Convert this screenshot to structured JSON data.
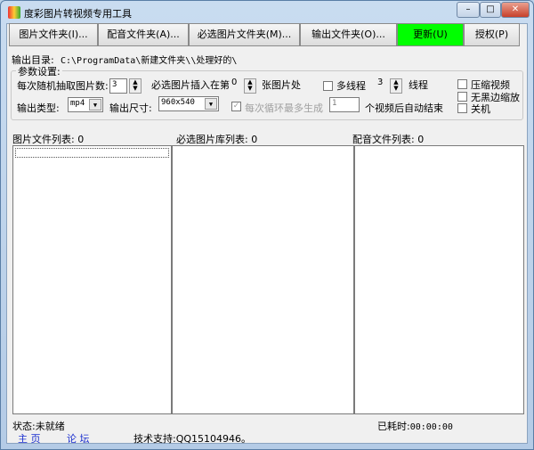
{
  "window": {
    "title": "度彩图片转视频专用工具",
    "controls": [
      "minimize",
      "maximize",
      "close"
    ]
  },
  "toolbar": [
    {
      "label": "图片文件夹(I)..."
    },
    {
      "label": "配音文件夹(A)..."
    },
    {
      "label": "必选图片文件夹(M)..."
    },
    {
      "label": "输出文件夹(O)..."
    },
    {
      "label": "更新(U)"
    },
    {
      "label": "授权(P)"
    }
  ],
  "colors": {
    "update_button": "#00ff00"
  },
  "output_dir": {
    "label": "输出目录:",
    "value": "C:\\ProgramData\\新建文件夹\\\\处理好的\\"
  },
  "params": {
    "legend": "参数设置:",
    "random_count_label": "每次随机抽取图片数:",
    "random_count": "3",
    "insert_label": "必选图片插入在第",
    "insert_value": "0",
    "insert_suffix": "张图片处",
    "multithread_label": "多线程",
    "multithread_checked": false,
    "threads": "3",
    "threads_suffix": "线程",
    "compress_label": "压缩视频",
    "compress_checked": false,
    "noblack_label": "无黑边缩放",
    "noblack_checked": false,
    "shutdown_label": "关机",
    "shutdown_checked": false,
    "type_label": "输出类型:",
    "type_value": "mp4",
    "size_label": "输出尺寸:",
    "size_value": "960x540",
    "loop_label": "每次循环最多生成",
    "loop_checked": true,
    "loop_value": "1",
    "loop_suffix": "个视频后自动结束"
  },
  "lists": [
    {
      "label": "图片文件列表:",
      "count": "0"
    },
    {
      "label": "必选图片库列表:",
      "count": "0"
    },
    {
      "label": "配音文件列表:",
      "count": "0"
    }
  ],
  "status": {
    "label": "状态:",
    "value": "未就绪",
    "elapsed_label": "已耗时:",
    "elapsed": "00:00:00"
  },
  "footer": {
    "home": "主 页",
    "forum": "论 坛",
    "support": "技术支持:QQ15104946。"
  }
}
